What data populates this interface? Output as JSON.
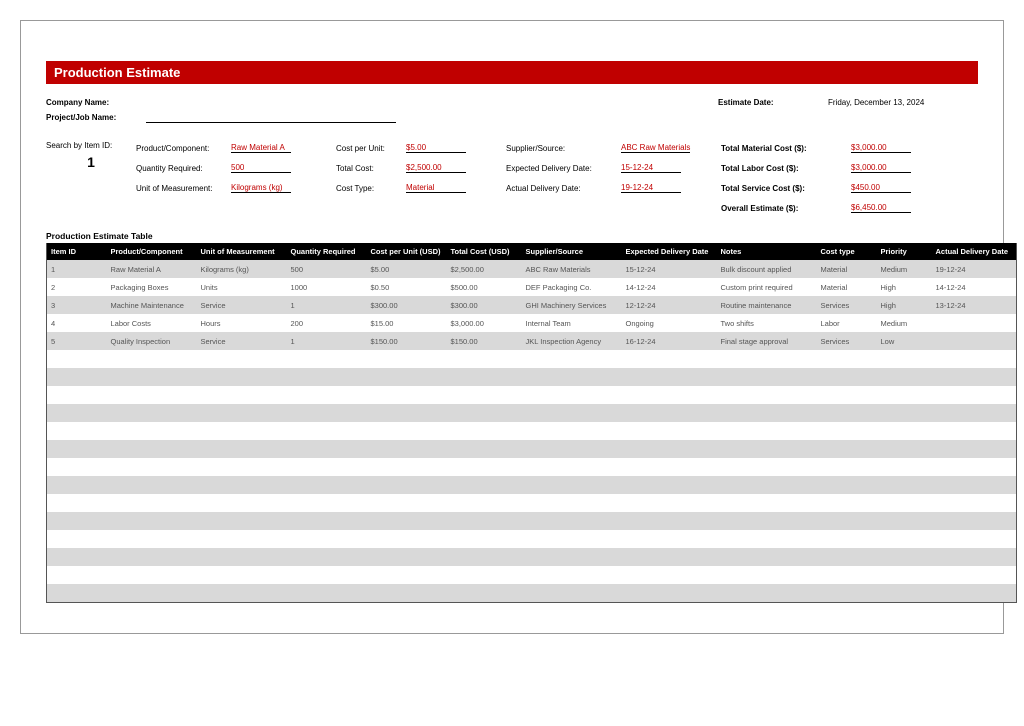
{
  "title": "Production Estimate",
  "header": {
    "company_label": "Company Name:",
    "project_label": "Project/Job Name:",
    "estimate_date_label": "Estimate Date:",
    "estimate_date_value": "Friday, December 13, 2024"
  },
  "search": {
    "label": "Search by Item ID:",
    "value": "1",
    "rows": {
      "product_label": "Product/Component:",
      "product_value": "Raw Material A",
      "qty_label": "Quantity Required:",
      "qty_value": "500",
      "uom_label": "Unit of Measurement:",
      "uom_value": "Kilograms (kg)",
      "cpu_label": "Cost per Unit:",
      "cpu_value": "$5.00",
      "total_cost_label": "Total Cost:",
      "total_cost_value": "$2,500.00",
      "cost_type_label": "Cost Type:",
      "cost_type_value": "Material",
      "supplier_label": "Supplier/Source:",
      "supplier_value": "ABC Raw Materials",
      "exp_date_label": "Expected Delivery Date:",
      "exp_date_value": "15-12-24",
      "act_date_label": "Actual Delivery Date:",
      "act_date_value": "19-12-24",
      "total_material_label": "Total Material Cost ($):",
      "total_material_value": "$3,000.00",
      "total_labor_label": "Total Labor Cost ($):",
      "total_labor_value": "$3,000.00",
      "total_service_label": "Total Service Cost ($):",
      "total_service_value": "$450.00",
      "overall_label": "Overall Estimate ($):",
      "overall_value": "$6,450.00"
    }
  },
  "table": {
    "title": "Production Estimate Table",
    "headers": [
      "Item ID",
      "Product/Component",
      "Unit of Measurement",
      "Quantity Required",
      "Cost per Unit (USD)",
      "Total Cost (USD)",
      "Supplier/Source",
      "Expected Delivery Date",
      "Notes",
      "Cost type",
      "Priority",
      "Actual Delivery Date"
    ],
    "rows": [
      [
        "1",
        "Raw Material A",
        "Kilograms (kg)",
        "500",
        "$5.00",
        "$2,500.00",
        "ABC Raw Materials",
        "15-12-24",
        "Bulk discount applied",
        "Material",
        "Medium",
        "19-12-24"
      ],
      [
        "2",
        "Packaging Boxes",
        "Units",
        "1000",
        "$0.50",
        "$500.00",
        "DEF Packaging Co.",
        "14-12-24",
        "Custom print required",
        "Material",
        "High",
        "14-12-24"
      ],
      [
        "3",
        "Machine Maintenance",
        "Service",
        "1",
        "$300.00",
        "$300.00",
        "GHI Machinery Services",
        "12-12-24",
        "Routine maintenance",
        "Services",
        "High",
        "13-12-24"
      ],
      [
        "4",
        "Labor Costs",
        "Hours",
        "200",
        "$15.00",
        "$3,000.00",
        "Internal Team",
        "Ongoing",
        "Two shifts",
        "Labor",
        "Medium",
        ""
      ],
      [
        "5",
        "Quality Inspection",
        "Service",
        "1",
        "$150.00",
        "$150.00",
        "JKL Inspection Agency",
        "16-12-24",
        "Final stage approval",
        "Services",
        "Low",
        ""
      ]
    ],
    "empty_rows": 14
  },
  "chart_data": {
    "type": "table",
    "title": "Production Estimate Table",
    "columns": [
      "Item ID",
      "Product/Component",
      "Unit of Measurement",
      "Quantity Required",
      "Cost per Unit (USD)",
      "Total Cost (USD)",
      "Supplier/Source",
      "Expected Delivery Date",
      "Notes",
      "Cost type",
      "Priority",
      "Actual Delivery Date"
    ],
    "rows": [
      {
        "Item ID": "1",
        "Product/Component": "Raw Material A",
        "Unit of Measurement": "Kilograms (kg)",
        "Quantity Required": 500,
        "Cost per Unit (USD)": 5.0,
        "Total Cost (USD)": 2500.0,
        "Supplier/Source": "ABC Raw Materials",
        "Expected Delivery Date": "15-12-24",
        "Notes": "Bulk discount applied",
        "Cost type": "Material",
        "Priority": "Medium",
        "Actual Delivery Date": "19-12-24"
      },
      {
        "Item ID": "2",
        "Product/Component": "Packaging Boxes",
        "Unit of Measurement": "Units",
        "Quantity Required": 1000,
        "Cost per Unit (USD)": 0.5,
        "Total Cost (USD)": 500.0,
        "Supplier/Source": "DEF Packaging Co.",
        "Expected Delivery Date": "14-12-24",
        "Notes": "Custom print required",
        "Cost type": "Material",
        "Priority": "High",
        "Actual Delivery Date": "14-12-24"
      },
      {
        "Item ID": "3",
        "Product/Component": "Machine Maintenance",
        "Unit of Measurement": "Service",
        "Quantity Required": 1,
        "Cost per Unit (USD)": 300.0,
        "Total Cost (USD)": 300.0,
        "Supplier/Source": "GHI Machinery Services",
        "Expected Delivery Date": "12-12-24",
        "Notes": "Routine maintenance",
        "Cost type": "Services",
        "Priority": "High",
        "Actual Delivery Date": "13-12-24"
      },
      {
        "Item ID": "4",
        "Product/Component": "Labor Costs",
        "Unit of Measurement": "Hours",
        "Quantity Required": 200,
        "Cost per Unit (USD)": 15.0,
        "Total Cost (USD)": 3000.0,
        "Supplier/Source": "Internal Team",
        "Expected Delivery Date": "Ongoing",
        "Notes": "Two shifts",
        "Cost type": "Labor",
        "Priority": "Medium",
        "Actual Delivery Date": ""
      },
      {
        "Item ID": "5",
        "Product/Component": "Quality Inspection",
        "Unit of Measurement": "Service",
        "Quantity Required": 1,
        "Cost per Unit (USD)": 150.0,
        "Total Cost (USD)": 150.0,
        "Supplier/Source": "JKL Inspection Agency",
        "Expected Delivery Date": "16-12-24",
        "Notes": "Final stage approval",
        "Cost type": "Services",
        "Priority": "Low",
        "Actual Delivery Date": ""
      }
    ],
    "totals": {
      "Total Material Cost ($)": 3000.0,
      "Total Labor Cost ($)": 3000.0,
      "Total Service Cost ($)": 450.0,
      "Overall Estimate ($)": 6450.0
    }
  }
}
